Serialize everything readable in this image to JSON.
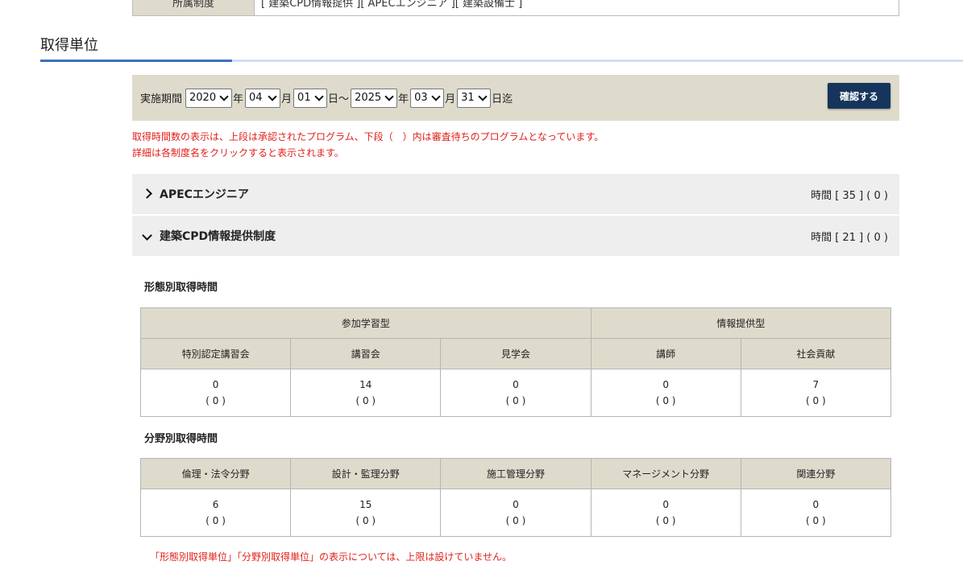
{
  "top_row": {
    "label": "所属制度",
    "value": "[ 建築CPD情報提供 ][ APECエンジニア ][ 建築設備士 ]"
  },
  "section_title": "取得単位",
  "filter": {
    "period_label": "実施期間",
    "start_year": "2020",
    "start_month": "04",
    "start_day": "01",
    "end_year": "2025",
    "end_month": "03",
    "end_day": "31",
    "year_unit": "年",
    "month_unit": "月",
    "day_unit_start": "日～",
    "day_unit_end": "日迄",
    "confirm_label": "確認する"
  },
  "notes": [
    "取得時間数の表示は、上段は承認されたプログラム、下段（　）内は審査待ちのプログラムとなっています。",
    "詳細は各制度名をクリックすると表示されます。"
  ],
  "programs": [
    {
      "name": "APECエンジニア",
      "hours": "時間 [ 35 ] ( 0 )",
      "expanded": false
    },
    {
      "name": "建築CPD情報提供制度",
      "hours": "時間 [ 21 ] ( 0 )",
      "expanded": true
    }
  ],
  "format_table": {
    "title": "形態別取得時間",
    "groups": [
      "参加学習型",
      "情報提供型"
    ],
    "columns": [
      "特別認定講習会",
      "講習会",
      "見学会",
      "講師",
      "社会貢献"
    ],
    "values": [
      "0",
      "14",
      "0",
      "0",
      "7"
    ],
    "pending": [
      "( 0 )",
      "( 0 )",
      "( 0 )",
      "( 0 )",
      "( 0 )"
    ]
  },
  "field_table": {
    "title": "分野別取得時間",
    "columns": [
      "倫理・法令分野",
      "設計・監理分野",
      "施工管理分野",
      "マネージメント分野",
      "関連分野"
    ],
    "values": [
      "6",
      "15",
      "0",
      "0",
      "0"
    ],
    "pending": [
      "( 0 )",
      "( 0 )",
      "( 0 )",
      "( 0 )",
      "( 0 )"
    ]
  },
  "bottom_note": "「形態別取得単位」「分野別取得単位」の表示については、上限は設けていません。"
}
